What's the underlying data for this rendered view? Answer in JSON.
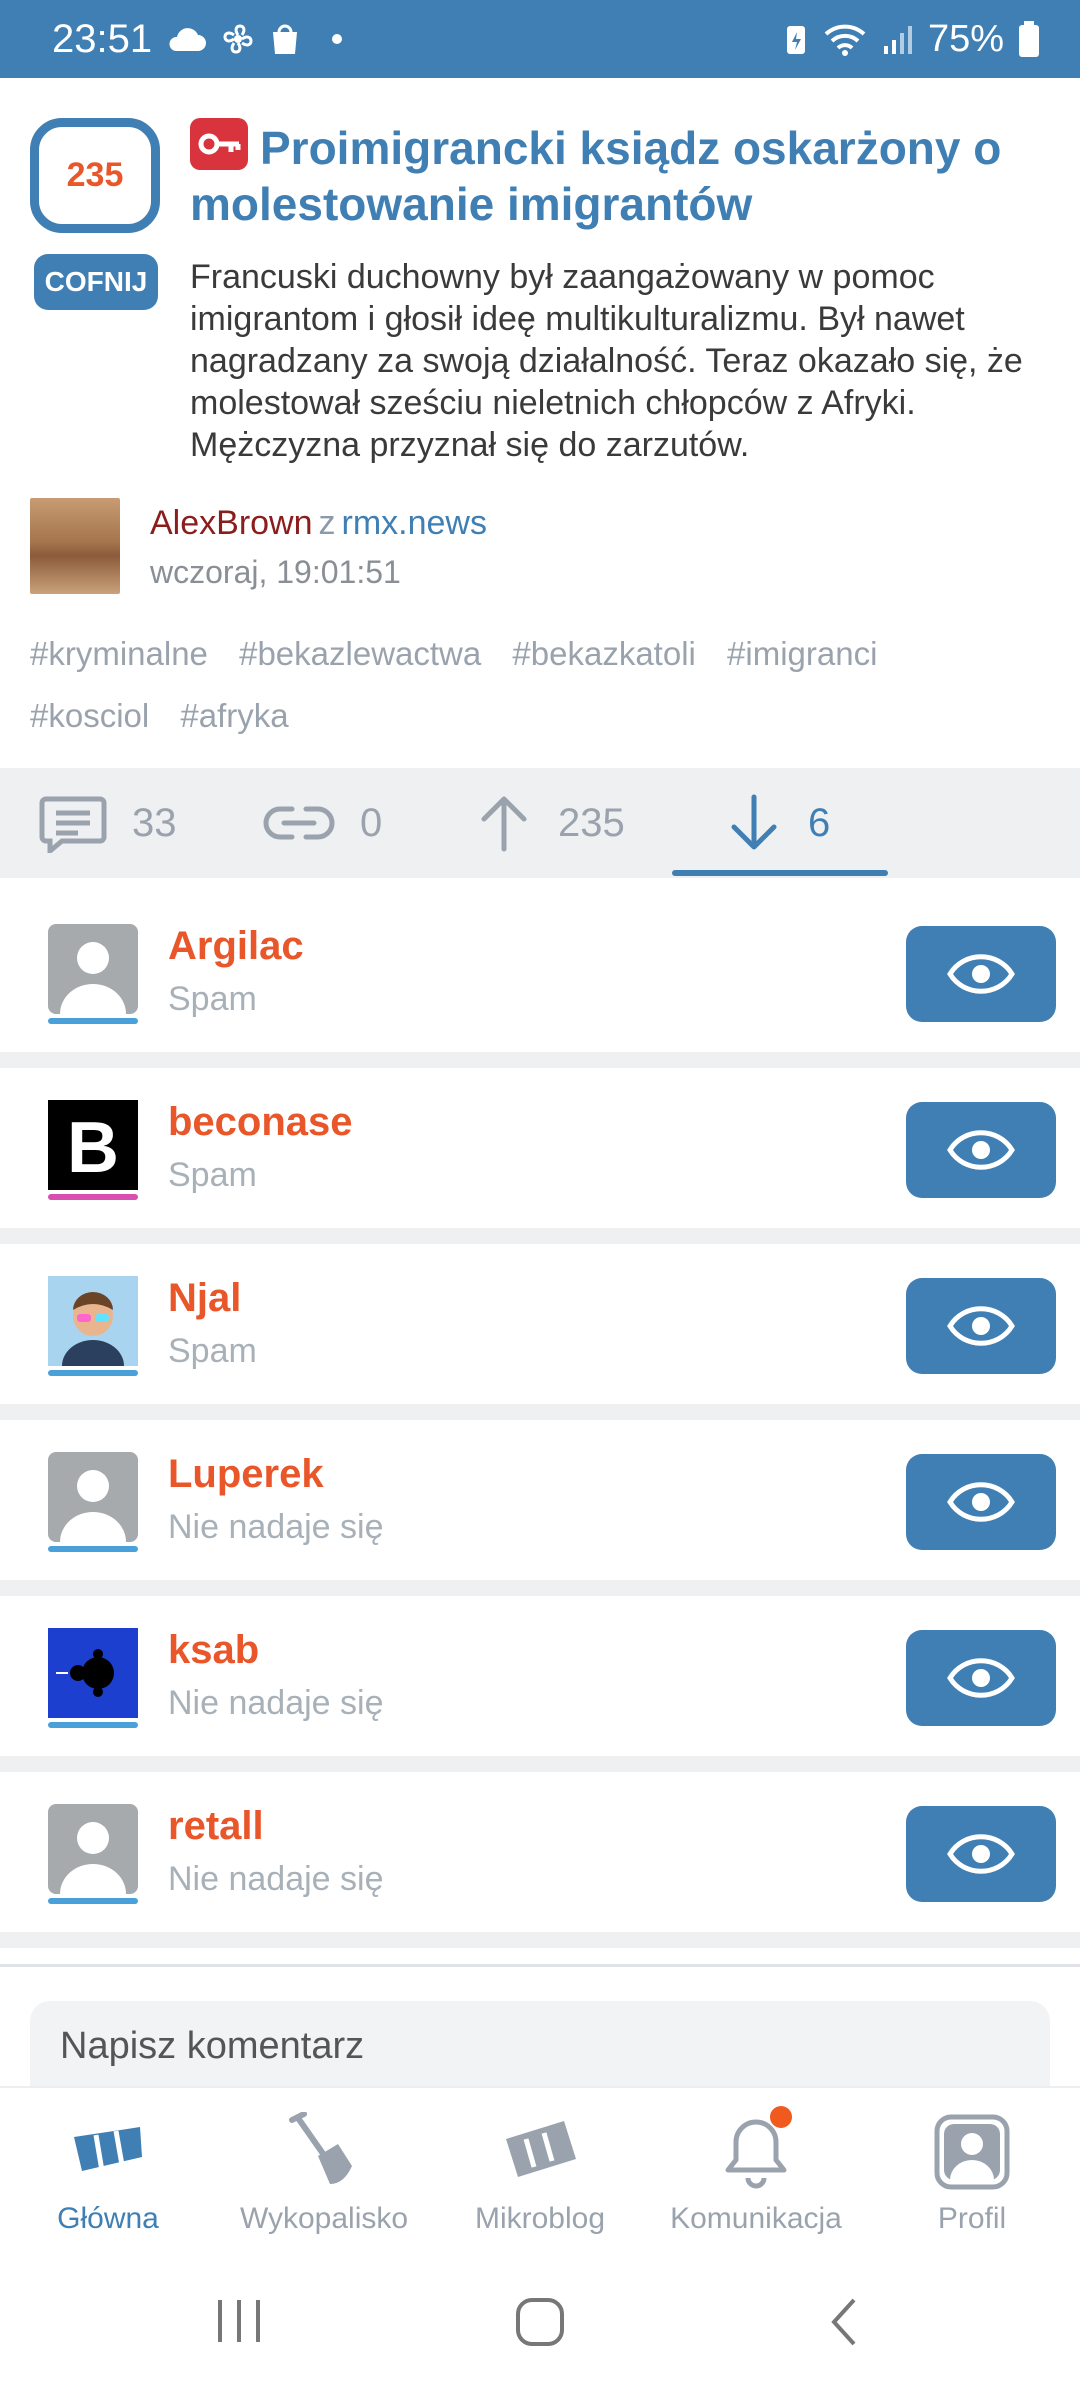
{
  "status_bar": {
    "time": "23:51",
    "battery": "75%"
  },
  "post": {
    "vote_count": "235",
    "undo_label": "COFNIJ",
    "title": "Proimigrancki ksiądz oskarżony o molestowanie imigrantów",
    "description": "Francuski duchowny był zaangażowany w pomoc imigrantom i głosił ideę multikulturalizmu. Był nawet nagradzany za swoją działalność. Teraz okazało się, że molestował sześciu nieletnich chłopców z Afryki. Mężczyzna przyznał się do zarzutów.",
    "author": "AlexBrown",
    "from_word": "z",
    "source": "rmx.news",
    "time": "wczoraj, 19:01:51",
    "tags": [
      "#kryminalne",
      "#bekazlewactwa",
      "#bekazkatoli",
      "#imigranci",
      "#kosciol",
      "#afryka"
    ]
  },
  "stats": {
    "comments": "33",
    "links": "0",
    "upvotes": "235",
    "downvotes": "6"
  },
  "voters": [
    {
      "name": "Argilac",
      "reason": "Spam",
      "avatar": "default"
    },
    {
      "name": "beconase",
      "reason": "Spam",
      "avatar": "letter-b"
    },
    {
      "name": "Njal",
      "reason": "Spam",
      "avatar": "cartoon"
    },
    {
      "name": "Luperek",
      "reason": "Nie nadaje się",
      "avatar": "default"
    },
    {
      "name": "ksab",
      "reason": "Nie nadaje się",
      "avatar": "fractal"
    },
    {
      "name": "retall",
      "reason": "Nie nadaje się",
      "avatar": "default"
    }
  ],
  "comment_placeholder": "Napisz komentarz",
  "bottom_nav": [
    {
      "label": "Główna",
      "icon": "home-icon",
      "active": true
    },
    {
      "label": "Wykopalisko",
      "icon": "shovel-icon",
      "active": false
    },
    {
      "label": "Mikroblog",
      "icon": "mikroblog-icon",
      "active": false
    },
    {
      "label": "Komunikacja",
      "icon": "bell-icon",
      "active": false
    },
    {
      "label": "Profil",
      "icon": "profile-icon",
      "active": false
    }
  ],
  "colors": {
    "accent": "#3f7fb3",
    "username": "#e8562a",
    "adult_badge": "#d9343d"
  }
}
